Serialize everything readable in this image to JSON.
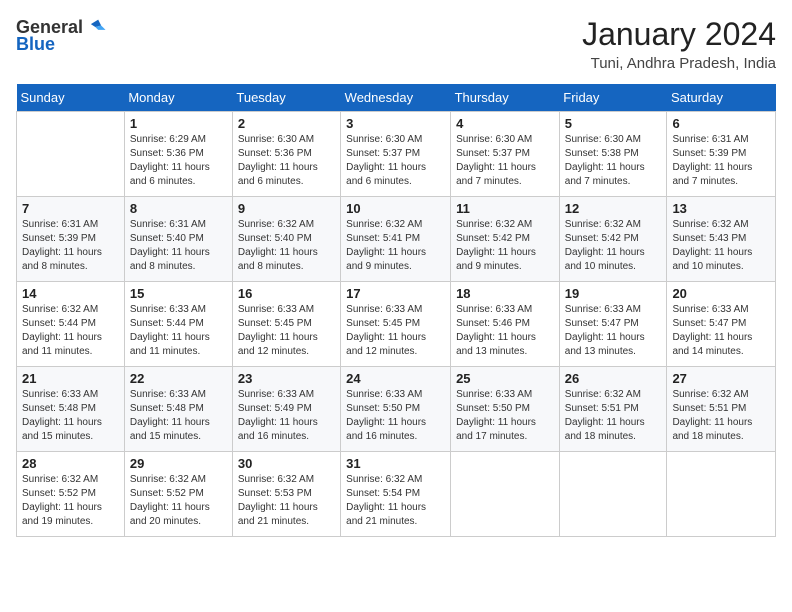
{
  "header": {
    "logo_general": "General",
    "logo_blue": "Blue",
    "month": "January 2024",
    "location": "Tuni, Andhra Pradesh, India"
  },
  "days_of_week": [
    "Sunday",
    "Monday",
    "Tuesday",
    "Wednesday",
    "Thursday",
    "Friday",
    "Saturday"
  ],
  "weeks": [
    [
      {
        "day": "",
        "info": ""
      },
      {
        "day": "1",
        "info": "Sunrise: 6:29 AM\nSunset: 5:36 PM\nDaylight: 11 hours\nand 6 minutes."
      },
      {
        "day": "2",
        "info": "Sunrise: 6:30 AM\nSunset: 5:36 PM\nDaylight: 11 hours\nand 6 minutes."
      },
      {
        "day": "3",
        "info": "Sunrise: 6:30 AM\nSunset: 5:37 PM\nDaylight: 11 hours\nand 6 minutes."
      },
      {
        "day": "4",
        "info": "Sunrise: 6:30 AM\nSunset: 5:37 PM\nDaylight: 11 hours\nand 7 minutes."
      },
      {
        "day": "5",
        "info": "Sunrise: 6:30 AM\nSunset: 5:38 PM\nDaylight: 11 hours\nand 7 minutes."
      },
      {
        "day": "6",
        "info": "Sunrise: 6:31 AM\nSunset: 5:39 PM\nDaylight: 11 hours\nand 7 minutes."
      }
    ],
    [
      {
        "day": "7",
        "info": "Sunrise: 6:31 AM\nSunset: 5:39 PM\nDaylight: 11 hours\nand 8 minutes."
      },
      {
        "day": "8",
        "info": "Sunrise: 6:31 AM\nSunset: 5:40 PM\nDaylight: 11 hours\nand 8 minutes."
      },
      {
        "day": "9",
        "info": "Sunrise: 6:32 AM\nSunset: 5:40 PM\nDaylight: 11 hours\nand 8 minutes."
      },
      {
        "day": "10",
        "info": "Sunrise: 6:32 AM\nSunset: 5:41 PM\nDaylight: 11 hours\nand 9 minutes."
      },
      {
        "day": "11",
        "info": "Sunrise: 6:32 AM\nSunset: 5:42 PM\nDaylight: 11 hours\nand 9 minutes."
      },
      {
        "day": "12",
        "info": "Sunrise: 6:32 AM\nSunset: 5:42 PM\nDaylight: 11 hours\nand 10 minutes."
      },
      {
        "day": "13",
        "info": "Sunrise: 6:32 AM\nSunset: 5:43 PM\nDaylight: 11 hours\nand 10 minutes."
      }
    ],
    [
      {
        "day": "14",
        "info": "Sunrise: 6:32 AM\nSunset: 5:44 PM\nDaylight: 11 hours\nand 11 minutes."
      },
      {
        "day": "15",
        "info": "Sunrise: 6:33 AM\nSunset: 5:44 PM\nDaylight: 11 hours\nand 11 minutes."
      },
      {
        "day": "16",
        "info": "Sunrise: 6:33 AM\nSunset: 5:45 PM\nDaylight: 11 hours\nand 12 minutes."
      },
      {
        "day": "17",
        "info": "Sunrise: 6:33 AM\nSunset: 5:45 PM\nDaylight: 11 hours\nand 12 minutes."
      },
      {
        "day": "18",
        "info": "Sunrise: 6:33 AM\nSunset: 5:46 PM\nDaylight: 11 hours\nand 13 minutes."
      },
      {
        "day": "19",
        "info": "Sunrise: 6:33 AM\nSunset: 5:47 PM\nDaylight: 11 hours\nand 13 minutes."
      },
      {
        "day": "20",
        "info": "Sunrise: 6:33 AM\nSunset: 5:47 PM\nDaylight: 11 hours\nand 14 minutes."
      }
    ],
    [
      {
        "day": "21",
        "info": "Sunrise: 6:33 AM\nSunset: 5:48 PM\nDaylight: 11 hours\nand 15 minutes."
      },
      {
        "day": "22",
        "info": "Sunrise: 6:33 AM\nSunset: 5:48 PM\nDaylight: 11 hours\nand 15 minutes."
      },
      {
        "day": "23",
        "info": "Sunrise: 6:33 AM\nSunset: 5:49 PM\nDaylight: 11 hours\nand 16 minutes."
      },
      {
        "day": "24",
        "info": "Sunrise: 6:33 AM\nSunset: 5:50 PM\nDaylight: 11 hours\nand 16 minutes."
      },
      {
        "day": "25",
        "info": "Sunrise: 6:33 AM\nSunset: 5:50 PM\nDaylight: 11 hours\nand 17 minutes."
      },
      {
        "day": "26",
        "info": "Sunrise: 6:32 AM\nSunset: 5:51 PM\nDaylight: 11 hours\nand 18 minutes."
      },
      {
        "day": "27",
        "info": "Sunrise: 6:32 AM\nSunset: 5:51 PM\nDaylight: 11 hours\nand 18 minutes."
      }
    ],
    [
      {
        "day": "28",
        "info": "Sunrise: 6:32 AM\nSunset: 5:52 PM\nDaylight: 11 hours\nand 19 minutes."
      },
      {
        "day": "29",
        "info": "Sunrise: 6:32 AM\nSunset: 5:52 PM\nDaylight: 11 hours\nand 20 minutes."
      },
      {
        "day": "30",
        "info": "Sunrise: 6:32 AM\nSunset: 5:53 PM\nDaylight: 11 hours\nand 21 minutes."
      },
      {
        "day": "31",
        "info": "Sunrise: 6:32 AM\nSunset: 5:54 PM\nDaylight: 11 hours\nand 21 minutes."
      },
      {
        "day": "",
        "info": ""
      },
      {
        "day": "",
        "info": ""
      },
      {
        "day": "",
        "info": ""
      }
    ]
  ]
}
